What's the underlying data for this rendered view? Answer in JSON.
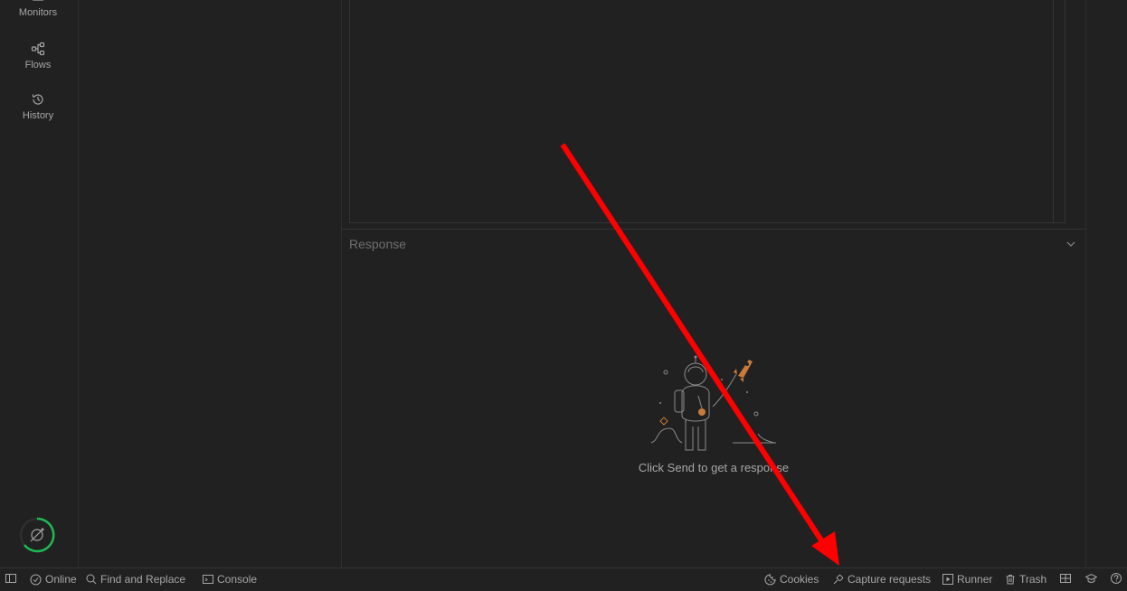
{
  "sidebar": {
    "items": [
      {
        "label": "Monitors",
        "icon": "monitor-icon"
      },
      {
        "label": "Flows",
        "icon": "flows-icon"
      },
      {
        "label": "History",
        "icon": "history-icon"
      }
    ]
  },
  "response": {
    "title": "Response",
    "empty_message": "Click Send to get a response"
  },
  "statusbar": {
    "online": "Online",
    "find_replace": "Find and Replace",
    "console": "Console",
    "cookies": "Cookies",
    "capture": "Capture requests",
    "runner": "Runner",
    "trash": "Trash"
  },
  "colors": {
    "background": "#212121",
    "accent_green": "#1db954",
    "annotation_red": "#ff0000",
    "rocket_orange": "#c97a3a"
  }
}
